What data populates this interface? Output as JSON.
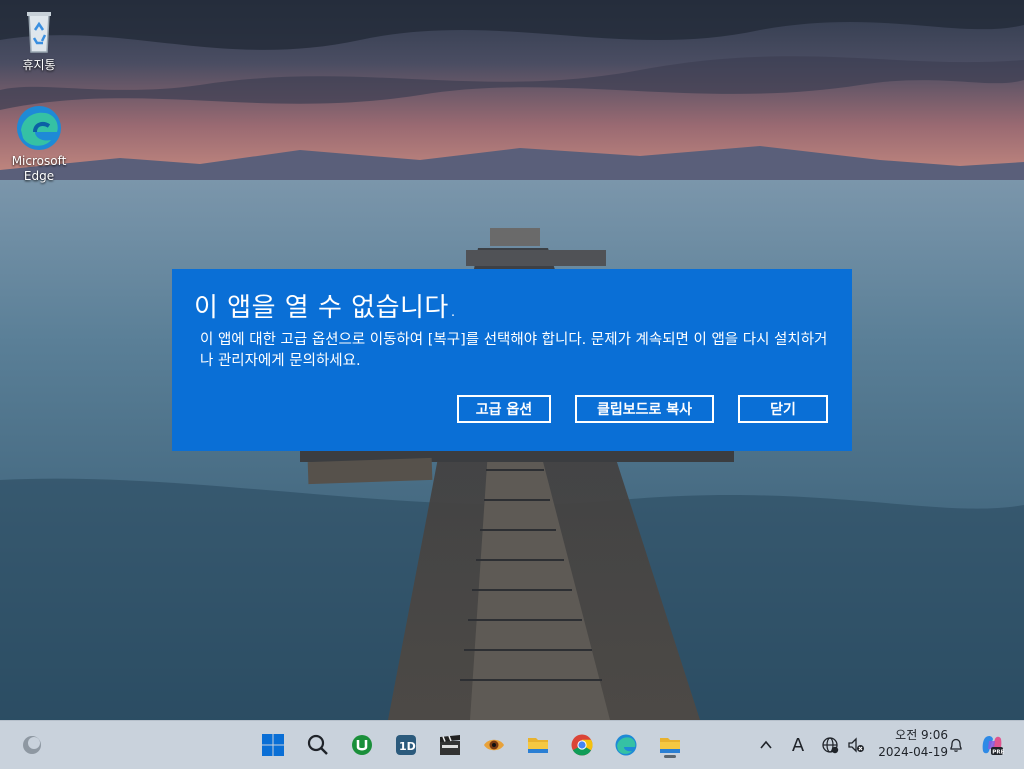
{
  "desktop": {
    "icons": [
      {
        "label": "휴지통"
      },
      {
        "label": "Microsoft Edge"
      }
    ]
  },
  "dialog": {
    "title": "이 앱을 열 수 없습니다.",
    "message": "이 앱에 대한 고급 옵션으로 이동하여 [복구]를 선택해야 합니다. 문제가 계속되면 이 앱을 다시 설치하거나 관리자에게 문의하세요.",
    "buttons": {
      "advanced": "고급 옵션",
      "copy": "클립보드로 복사",
      "close": "닫기"
    },
    "accent_color": "#0a6fd6"
  },
  "taskbar": {
    "pinned": [
      "start-icon",
      "search-icon",
      "utorrent-icon",
      "app-1d-icon",
      "video-editor-icon",
      "eye-app-icon",
      "file-explorer-icon",
      "chrome-icon",
      "edge-icon",
      "file-explorer-active-icon"
    ],
    "tray": {
      "input_indicator": "A",
      "time": "오전 9:06",
      "date": "2024-04-19"
    }
  }
}
